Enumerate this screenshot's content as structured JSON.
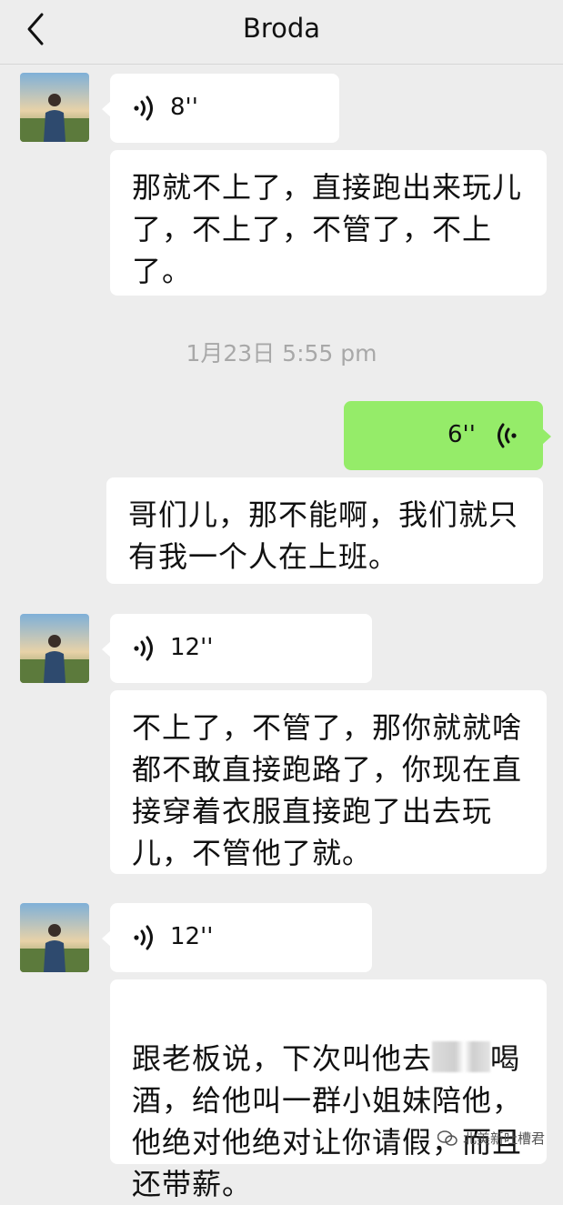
{
  "header": {
    "title": "Broda"
  },
  "messages": {
    "m1_duration": "8''",
    "m2_text": "那就不上了，直接跑出来玩儿\n了，不上了，不管了，不上\n了。",
    "timestamp": "1月23日 5:55 pm",
    "m3_duration": "6''",
    "m4_text": "哥们儿，那不能啊，我们就只\n有我一个人在上班。",
    "m5_duration": "12''",
    "m6_text": "不上了，不管了，那你就就啥\n都不敢直接跑路了，你现在直\n接穿着衣服直接跑了出去玩\n儿，不管他了就。",
    "m7_duration": "12''",
    "m8_line1a": "跟老板说，下次叫他去",
    "m8_line1b": "喝",
    "m8_rest": "酒，给他叫一群小姐妹陪他，\n他绝对他绝对让你请假，而且\n还带薪。"
  },
  "watermark": {
    "text": "北美新吐槽君"
  },
  "colors": {
    "background": "#ededed",
    "bubble": "#ffffff",
    "sent_bubble": "#95ec69",
    "timestamp": "#a8a8a8"
  },
  "icons": {
    "back": "chevron-left-icon",
    "voice": "voice-wave-icon",
    "watermark": "wechat-logo-icon"
  }
}
